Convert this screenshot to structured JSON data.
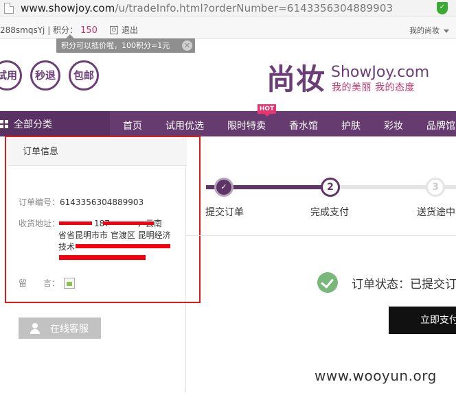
{
  "browser": {
    "url_host": "www.showjoy.com",
    "url_path": "/u/tradeInfo.html?orderNumber=6143356304889903",
    "shield_icon": "shield-check-icon"
  },
  "topbar": {
    "user_text": "288smqsYj | 积分：",
    "points": "150",
    "logout": "退出",
    "my_account": "我的尚妆",
    "tooltip": "积分可以抵价啦，100积分=1元"
  },
  "header": {
    "circle_buttons": [
      "试用",
      "秒退",
      "包邮"
    ],
    "logo_cn": "尚妆",
    "logo_en_a": "ShowJoy",
    "logo_en_b": ".com",
    "slogan": "我的美丽 我的态度"
  },
  "nav": {
    "all_categories": "全部分类",
    "items": [
      "首页",
      "试用优选",
      "限时特卖",
      "香水馆",
      "护肤",
      "彩妆",
      "品牌馆"
    ],
    "hot_badge": "HOT"
  },
  "order_info": {
    "title": "订单信息",
    "number_label": "订单编号：",
    "number": "6143356304889903",
    "address_label": "收货地址：",
    "address_line1": "187",
    "address_line1_tail": "，云南",
    "address_line2": "省省昆明市市 官渡区 昆明经济",
    "address_line3": "技术",
    "message_label": "留　　言：",
    "customer_service": "在线客服"
  },
  "progress": {
    "steps": [
      {
        "num": "✓",
        "label": "提交订单"
      },
      {
        "num": "2",
        "label": "完成支付"
      },
      {
        "num": "3",
        "label": "送货途中"
      }
    ],
    "current_step": 2
  },
  "status": {
    "text": "订单状态：已提交订",
    "pay_button": "立即支付"
  },
  "watermark": "www.wooyun.org",
  "colors": {
    "brand_purple": "#663b6f",
    "brand_pink": "#c5356e",
    "highlight_red": "#e01919"
  }
}
